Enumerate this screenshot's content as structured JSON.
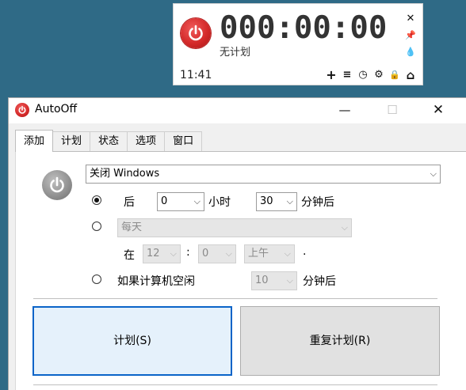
{
  "widget": {
    "time": "000:00:00",
    "status": "无计划",
    "clock": "11:41",
    "close_glyph": "✕",
    "pin_glyph": "📌",
    "drop_glyph": "💧",
    "tools": [
      {
        "name": "add-icon",
        "glyph": "+"
      },
      {
        "name": "menu-icon",
        "glyph": "≡"
      },
      {
        "name": "clock-icon",
        "glyph": "◷"
      },
      {
        "name": "gear-icon",
        "glyph": "⚙"
      },
      {
        "name": "lock-icon",
        "glyph": "🔒"
      },
      {
        "name": "home-icon",
        "glyph": "⌂"
      }
    ],
    "accent": "#d42a2a"
  },
  "window": {
    "title": "AutoOff",
    "min_glyph": "—",
    "max_glyph": "☐",
    "close_glyph": "✕"
  },
  "tabs": [
    {
      "label": "添加",
      "active": true
    },
    {
      "label": "计划",
      "active": false
    },
    {
      "label": "状态",
      "active": false
    },
    {
      "label": "选项",
      "active": false
    },
    {
      "label": "窗口",
      "active": false
    }
  ],
  "form": {
    "action": "关闭 Windows",
    "option1": {
      "prefix": "后",
      "hours_value": "0",
      "hours_unit": "小时",
      "minutes_value": "30",
      "minutes_unit": "分钟后",
      "checked": true
    },
    "option2": {
      "frequency": "每天",
      "at_label": "在",
      "hour": "12",
      "colon": ":",
      "minute": "0",
      "ampm": "上午",
      "period": ".",
      "checked": false
    },
    "option3": {
      "label": "如果计算机空闲",
      "minutes_value": "10",
      "minutes_unit": "分钟后",
      "checked": false
    }
  },
  "buttons": {
    "schedule": "计划(S)",
    "repeat": "重复计划(R)"
  },
  "arrow_glyph": "⌵"
}
